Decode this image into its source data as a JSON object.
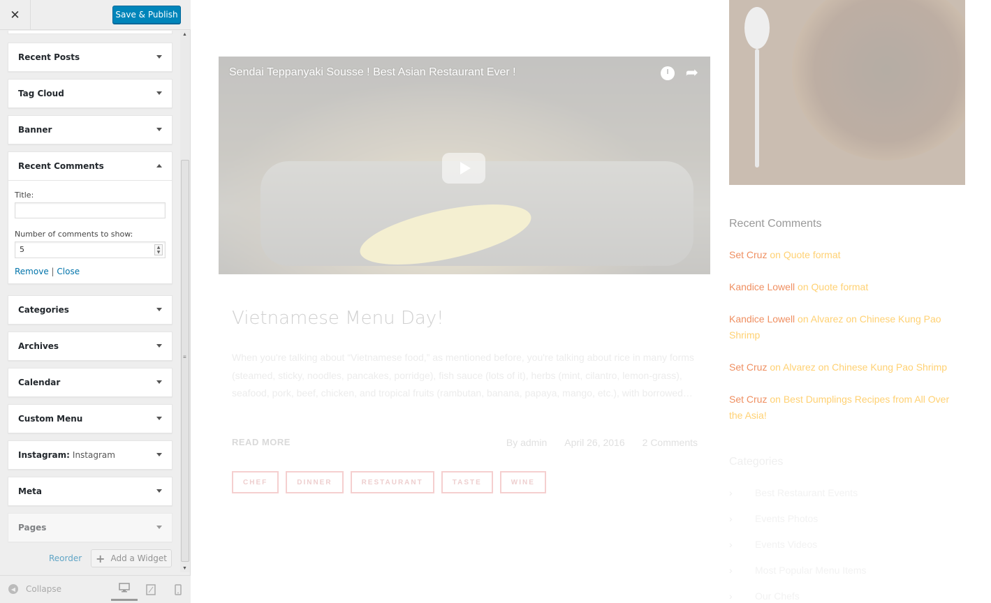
{
  "header": {
    "close_glyph": "✕",
    "publish_label": "Save & Publish"
  },
  "widgets": [
    {
      "label": "Recent Posts"
    },
    {
      "label": "Tag Cloud"
    },
    {
      "label": "Banner"
    },
    {
      "label": "Recent Comments"
    },
    {
      "label": "Categories"
    },
    {
      "label": "Archives"
    },
    {
      "label": "Calendar"
    },
    {
      "label": "Custom Menu"
    },
    {
      "label": "Instagram:",
      "sublabel": "Instagram"
    },
    {
      "label": "Meta"
    },
    {
      "label": "Pages"
    }
  ],
  "recent_comments_form": {
    "title_label": "Title:",
    "title_value": "",
    "count_label": "Number of comments to show:",
    "count_value": "5",
    "remove_label": "Remove",
    "separator": "|",
    "close_label": "Close"
  },
  "sidebar_actions": {
    "reorder_label": "Reorder",
    "add_widget_label": "Add a Widget"
  },
  "footer": {
    "collapse_label": "Collapse",
    "devices": [
      "desktop",
      "tablet",
      "mobile"
    ],
    "active_device": "desktop"
  },
  "preview": {
    "video": {
      "title": "Sendai Teppanyaki Sousse ! Best Asian Restaurant Ever !"
    },
    "post": {
      "title": "Vietnamese Menu Day!",
      "excerpt": "When you're talking about “Vietnamese food,” as mentioned before, you're talking about rice in many forms (steamed, sticky, noodles, pancakes, porridge), fish sauce (lots of it), herbs (mint, cilantro, lemon-grass), seafood, pork, beef, chicken, and tropical fruits (rambutan, banana, papaya, mango, etc.), with borrowed…",
      "read_more": "READ MORE",
      "author": "By admin",
      "date": "April 26, 2016",
      "comments": "2 Comments",
      "tags": [
        "CHEF",
        "DINNER",
        "RESTAURANT",
        "TASTE",
        "WINE"
      ]
    },
    "recent_comments": {
      "title": "Recent Comments",
      "items": [
        {
          "author": "Set Cruz",
          "text": " on Quote format"
        },
        {
          "author": "Kandice Lowell",
          "text": " on Quote format"
        },
        {
          "author": "Kandice Lowell",
          "text": " on Alvarez on Chinese Kung Pao Shrimp"
        },
        {
          "author": "Set Cruz",
          "text": " on Alvarez on Chinese Kung Pao Shrimp"
        },
        {
          "author": "Set Cruz",
          "text": " on Best Dumplings Recipes from All Over the Asia!"
        }
      ]
    },
    "categories": {
      "title": "Categories",
      "items": [
        "Best Restaurant Events",
        "Events Photos",
        "Events Videos",
        "Most Popular Menu Items",
        "Our Chefs"
      ]
    }
  },
  "colors": {
    "publish_bg": "#0085ba",
    "link": "#0073aa",
    "comment_author": "#ef8f61",
    "comment_link": "#ffd173"
  }
}
